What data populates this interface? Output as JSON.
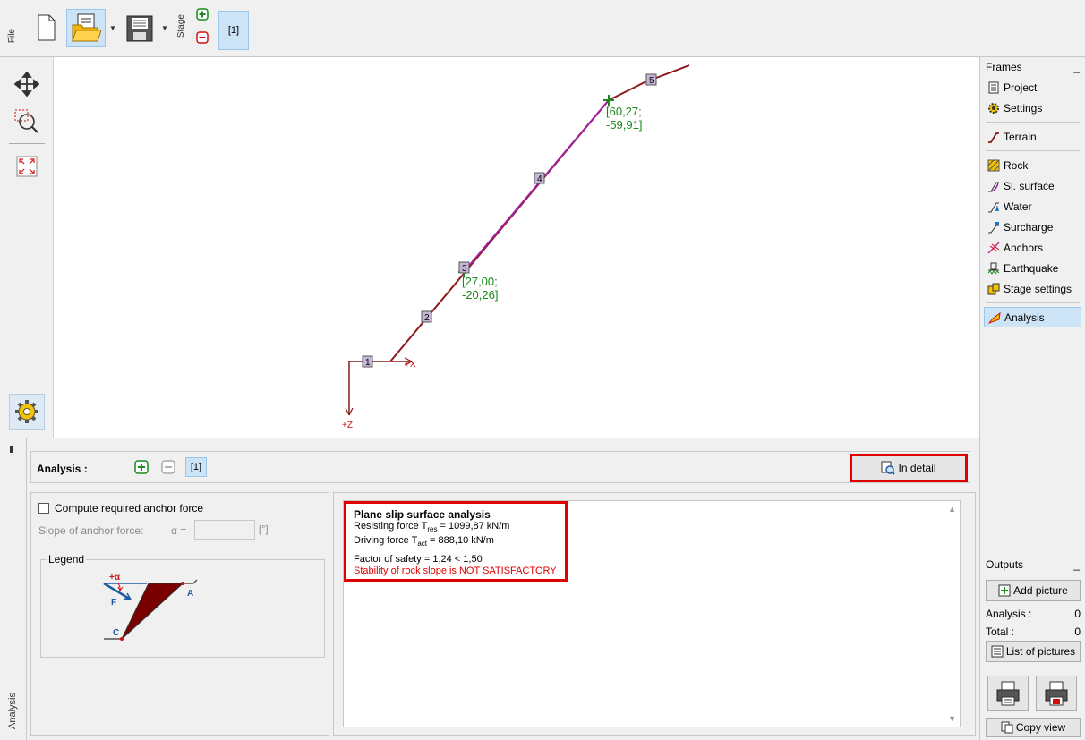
{
  "toolbar": {
    "file_label": "File",
    "stage_label": "Stage",
    "stage_button": "[1]"
  },
  "frames": {
    "title": "Frames",
    "collapse": "_",
    "items": [
      {
        "label": "Project",
        "icon": "document-icon"
      },
      {
        "label": "Settings",
        "icon": "gear-icon"
      },
      {
        "label": "Terrain",
        "icon": "terrain-icon"
      },
      {
        "label": "Rock",
        "icon": "rock-icon"
      },
      {
        "label": "Sl. surface",
        "icon": "slip-surface-icon"
      },
      {
        "label": "Water",
        "icon": "water-icon"
      },
      {
        "label": "Surcharge",
        "icon": "surcharge-icon"
      },
      {
        "label": "Anchors",
        "icon": "anchors-icon"
      },
      {
        "label": "Earthquake",
        "icon": "earthquake-icon"
      },
      {
        "label": "Stage settings",
        "icon": "stage-settings-icon"
      },
      {
        "label": "Analysis",
        "icon": "analysis-icon"
      }
    ]
  },
  "canvas": {
    "point_upper": [
      "[60,27;",
      "-59,91]"
    ],
    "point_lower": [
      "[27,00;",
      "-20,26]"
    ],
    "axis_x": "+X",
    "axis_z": "+Z",
    "markers": [
      "1",
      "2",
      "3",
      "4",
      "5"
    ]
  },
  "analysis": {
    "side_label": "Analysis",
    "title": "Analysis :",
    "stage_button": "[1]",
    "in_detail": "In detail",
    "compute_anchor": "Compute required anchor force",
    "slope_label": "Slope of anchor force:",
    "alpha_label": "α =",
    "alpha_value": "",
    "unit": "[°]",
    "legend_title": "Legend",
    "legend_labels": {
      "alpha": "+α",
      "force": "F",
      "a": "A",
      "c": "C"
    }
  },
  "results": {
    "heading": "Plane slip surface analysis",
    "resisting_prefix": "Resisting force  T",
    "resisting_sub": "res",
    "resisting_value": " =  1099,87 kN/m",
    "driving_prefix": "Driving force     T",
    "driving_sub": "act",
    "driving_value": " =   888,10 kN/m",
    "factor": "Factor of safety = 1,24 < 1,50",
    "verdict": "Stability of rock slope is NOT SATISFACTORY"
  },
  "outputs": {
    "title": "Outputs",
    "collapse": "_",
    "add_picture": "Add picture",
    "analysis_label": "Analysis :",
    "analysis_count": "0",
    "total_label": "Total :",
    "total_count": "0",
    "list_pictures": "List of pictures",
    "copy_view": "Copy view"
  },
  "colors": {
    "terrain": "#8b1a1a",
    "slip": "#a020a0",
    "green": "#1a8a1a",
    "highlight": "#e00000",
    "active_bg": "#cde4f7"
  }
}
